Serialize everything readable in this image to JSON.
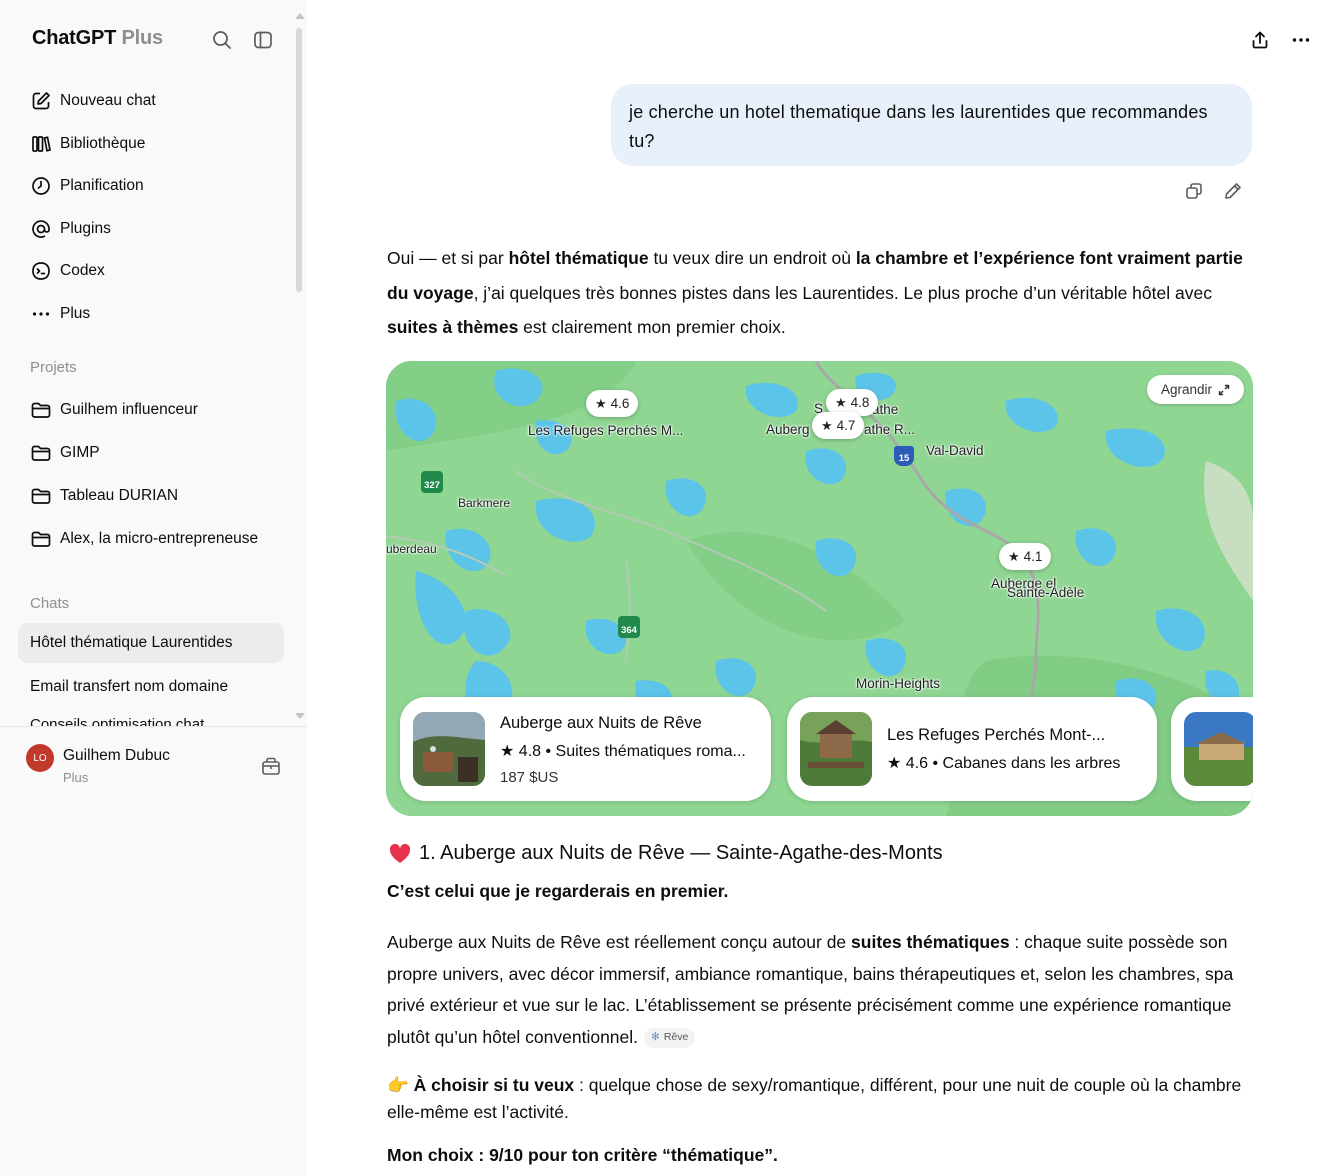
{
  "sidebar": {
    "app_title": "ChatGPT",
    "app_plan": "Plus",
    "nav": [
      {
        "label": "Nouveau chat",
        "icon": "edit-icon"
      },
      {
        "label": "Bibliothèque",
        "icon": "library-icon"
      },
      {
        "label": "Planification",
        "icon": "clock-icon"
      },
      {
        "label": "Plugins",
        "icon": "at-icon"
      },
      {
        "label": "Codex",
        "icon": "codex-icon"
      },
      {
        "label": "Plus",
        "icon": "more-dots-icon"
      }
    ],
    "projects_label": "Projets",
    "projects": [
      {
        "label": "Guilhem influenceur"
      },
      {
        "label": "GIMP"
      },
      {
        "label": "Tableau DURIAN"
      },
      {
        "label": "Alex, la micro-entrepreneuse"
      }
    ],
    "chats_label": "Chats",
    "chats": [
      {
        "label": "Hôtel thématique Laurentides",
        "active": true
      },
      {
        "label": "Email transfert nom domaine",
        "active": false
      }
    ],
    "chat_partial": "Conseils optimisation chat",
    "user": {
      "initials": "LO",
      "name": "Guilhem Dubuc",
      "plan": "Plus"
    }
  },
  "conversation": {
    "user_message": "je cherche un hotel thematique dans les laurentides que recommandes tu?",
    "intro": {
      "t1": "Oui — et si par ",
      "b1": "hôtel thématique",
      "t2": " tu veux dire un endroit où ",
      "b2": "la chambre et l’expérience font vraiment partie du voyage",
      "t3": ", j’ai quelques très bonnes pistes dans les Laurentides. Le plus proche d’un véritable hôtel avec ",
      "b3": "suites à thèmes",
      "t4": " est clairement mon premier choix."
    },
    "map": {
      "expand_label": "Agrandir",
      "pins": [
        {
          "rating": "4.6",
          "label": "Les Refuges Perchés M..."
        },
        {
          "rating": "4.8",
          "label": ""
        },
        {
          "rating": "4.7",
          "label": "Auberg"
        },
        {
          "rating": "4.1",
          "label": "Auberge el"
        }
      ],
      "place_labels": [
        "Val-David",
        "Barkmere",
        "uberdeau",
        "Sainte-Adèle",
        "Morin-Heights",
        "S",
        "athe",
        "athe R..."
      ],
      "route_shields": [
        "327",
        "364",
        "15"
      ],
      "cards": [
        {
          "title": "Auberge aux Nuits de Rêve",
          "rating": "4.8",
          "desc": "Suites thématiques roma...",
          "price": "187 $US"
        },
        {
          "title": "Les Refuges Perchés Mont-...",
          "rating": "4.6",
          "desc": "Cabanes dans les arbres",
          "price": ""
        }
      ]
    },
    "section1": {
      "title": "1. Auberge aux Nuits de Rêve — Sainte-Agathe-des-Monts",
      "subtitle": "C’est celui que je regarderais en premier.",
      "p_t1": "Auberge aux Nuits de Rêve est réellement conçu autour de ",
      "p_b1": "suites thématiques",
      "p_t2": " : chaque suite possède son propre univers, avec décor immersif, ambiance romantique, bains thérapeutiques et, selon les chambres, spa privé extérieur et vue sur le lac. L’établissement se présente précisément comme une expérience romantique plutôt qu’un hôtel conventionnel.",
      "source_chip": "Rêve",
      "choose_emoji": "👉",
      "choose_bold": "À choisir si tu veux",
      "choose_text": " : quelque chose de sexy/romantique, différent, pour une nuit de couple où la chambre elle-même est l’activité.",
      "verdict": "Mon choix : 9/10 pour ton critère “thématique”."
    }
  }
}
